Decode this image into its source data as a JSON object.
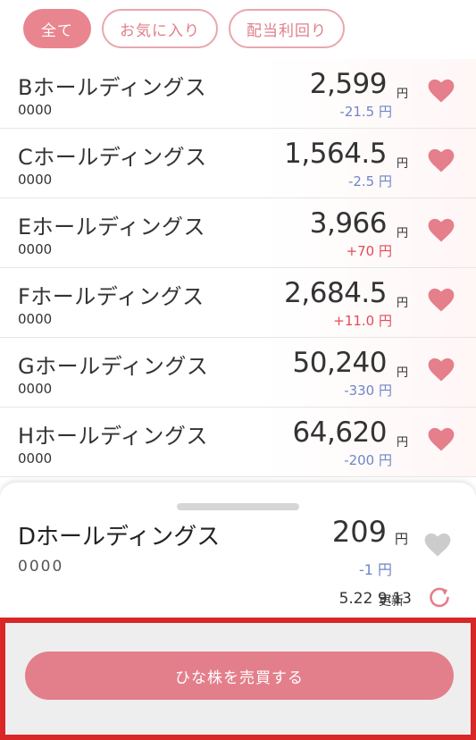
{
  "filters": {
    "all": "全て",
    "favorites": "お気に入り",
    "dividend": "配当利回り"
  },
  "stocks": [
    {
      "name": "Bホールディングス",
      "code": "0000",
      "price": "2,599",
      "unit": "円",
      "change": "-21.5 円",
      "direction": "down"
    },
    {
      "name": "Cホールディングス",
      "code": "0000",
      "price": "1,564.5",
      "unit": "円",
      "change": "-2.5 円",
      "direction": "down"
    },
    {
      "name": "Eホールディングス",
      "code": "0000",
      "price": "3,966",
      "unit": "円",
      "change": "+70 円",
      "direction": "up"
    },
    {
      "name": "Fホールディングス",
      "code": "0000",
      "price": "2,684.5",
      "unit": "円",
      "change": "+11.0 円",
      "direction": "up"
    },
    {
      "name": "Gホールディングス",
      "code": "0000",
      "price": "50,240",
      "unit": "円",
      "change": "-330 円",
      "direction": "down"
    },
    {
      "name": "Hホールディングス",
      "code": "0000",
      "price": "64,620",
      "unit": "円",
      "change": "-200 円",
      "direction": "down"
    }
  ],
  "selected": {
    "name": "Dホールディングス",
    "code": "0000",
    "price": "209",
    "unit": "円",
    "change": "-1 円",
    "updated_time": "5.22 9:13",
    "updated_label": "更新"
  },
  "trade_button": "ひな株を売買する",
  "colors": {
    "accent": "#e9858f",
    "heart_active": "#e57f8b",
    "heart_inactive": "#cccccc",
    "change_down": "#6f86c6",
    "change_up": "#e24b57",
    "highlight_frame": "#d92626"
  },
  "icons": {
    "favorite": "heart-icon",
    "refresh": "refresh-icon"
  }
}
